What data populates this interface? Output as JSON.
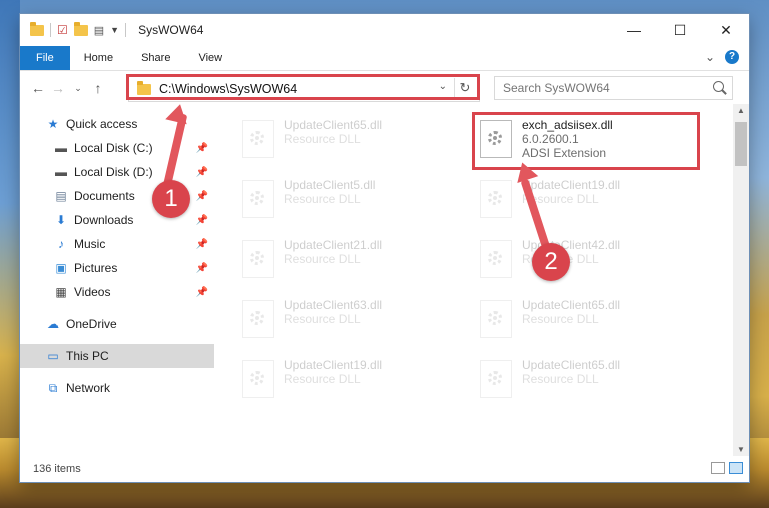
{
  "window": {
    "title": "SysWOW64",
    "controls": {
      "minimize": "—",
      "maximize": "☐",
      "close": "✕"
    }
  },
  "ribbon": {
    "tabs": [
      "File",
      "Home",
      "Share",
      "View"
    ],
    "expand": "⌄",
    "help": "?"
  },
  "address": {
    "path": "C:\\Windows\\SysWOW64",
    "search_placeholder": "Search SysWOW64"
  },
  "sidebar": {
    "items": [
      {
        "label": "Quick access",
        "icon": "star-icon"
      },
      {
        "label": "Local Disk (C:)",
        "icon": "drive-icon"
      },
      {
        "label": "Local Disk (D:)",
        "icon": "drive-icon"
      },
      {
        "label": "Documents",
        "icon": "documents-icon"
      },
      {
        "label": "Downloads",
        "icon": "download-icon"
      },
      {
        "label": "Music",
        "icon": "music-icon"
      },
      {
        "label": "Pictures",
        "icon": "pictures-icon"
      },
      {
        "label": "Videos",
        "icon": "videos-icon"
      },
      {
        "label": "OneDrive",
        "icon": "cloud-icon"
      },
      {
        "label": "This PC",
        "icon": "computer-icon"
      },
      {
        "label": "Network",
        "icon": "network-icon"
      }
    ]
  },
  "files": [
    {
      "name": "UpdateClient65.dll",
      "type": "Resource DLL"
    },
    {
      "name": "exch_adsiisex.dll",
      "version": "6.0.2600.1",
      "type": "ADSI Extension"
    },
    {
      "name": "UpdateClient5.dll",
      "type": "Resource DLL"
    },
    {
      "name": "UpdateClient19.dll",
      "type": "Resource DLL"
    },
    {
      "name": "UpdateClient21.dll",
      "type": "Resource DLL"
    },
    {
      "name": "UpdateClient42.dll",
      "type": "Resource DLL"
    },
    {
      "name": "UpdateClient63.dll",
      "type": "Resource DLL"
    },
    {
      "name": "UpdateClient65.dll",
      "type": "Resource DLL"
    },
    {
      "name": "UpdateClient19.dll",
      "type": "Resource DLL"
    },
    {
      "name": "UpdateClient65.dll",
      "type": "Resource DLL"
    }
  ],
  "status": {
    "item_count": "136 items"
  },
  "annotations": {
    "step1": "1",
    "step2": "2"
  },
  "colors": {
    "accent": "#1979ca",
    "highlight": "#d9444c"
  }
}
